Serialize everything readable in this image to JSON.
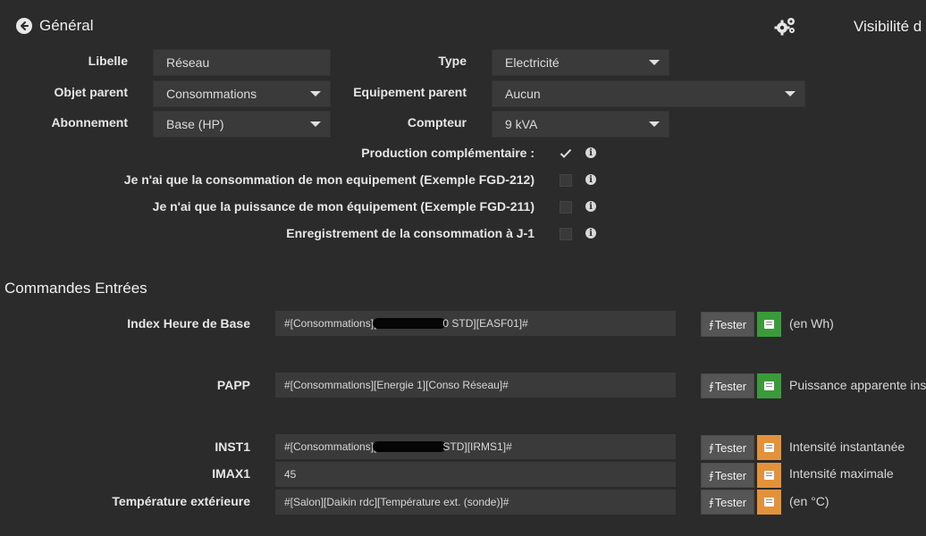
{
  "header": {
    "title": "Général",
    "right_title": "Visibilité d"
  },
  "form": {
    "libelle": {
      "label": "Libelle",
      "value": "Réseau"
    },
    "type": {
      "label": "Type",
      "value": "Electricité"
    },
    "objet_parent": {
      "label": "Objet parent",
      "value": "Consommations"
    },
    "equipement_parent": {
      "label": "Equipement parent",
      "value": "Aucun"
    },
    "abonnement": {
      "label": "Abonnement",
      "value": "Base (HP)"
    },
    "compteur": {
      "label": "Compteur",
      "value": "9 kVA"
    },
    "checkboxes": [
      {
        "label": "Production complémentaire :",
        "checked": true
      },
      {
        "label": "Je n'ai que la consommation de mon equipement (Exemple FGD-212)",
        "checked": false
      },
      {
        "label": "Je n'ai que la puissance de mon équipement (Exemple FGD-211)",
        "checked": false
      },
      {
        "label": "Enregistrement de la consommation à J-1",
        "checked": false
      }
    ]
  },
  "commands": {
    "section_title": "Commandes Entrées",
    "tester_label": "Tester",
    "rows": [
      {
        "label": "Index Heure de Base",
        "value_prefix": "#[Consommations][",
        "value_suffix": "0 STD][EASF01]#",
        "redacted": true,
        "color": "#3a9b3a",
        "desc": "(en Wh)"
      },
      {
        "label": "PAPP",
        "value_prefix": "#[Consommations][Energie 1][Conso Réseau]#",
        "value_suffix": "",
        "redacted": false,
        "color": "#3a9b3a",
        "desc": "Puissance apparente ins"
      },
      {
        "label": "INST1",
        "value_prefix": "#[Consommations][",
        "value_suffix": " STD][IRMS1]#",
        "redacted": true,
        "color": "#e3923b",
        "desc": "Intensité instantanée"
      },
      {
        "label": "IMAX1",
        "value_prefix": "45",
        "value_suffix": "",
        "redacted": false,
        "color": "#e3923b",
        "desc": "Intensité maximale"
      },
      {
        "label": "Température extérieure",
        "value_prefix": "#[Salon][Daikin rdc][Température ext. (sonde)]#",
        "value_suffix": "",
        "redacted": false,
        "color": "#e3923b",
        "desc": "(en °C)"
      }
    ]
  }
}
